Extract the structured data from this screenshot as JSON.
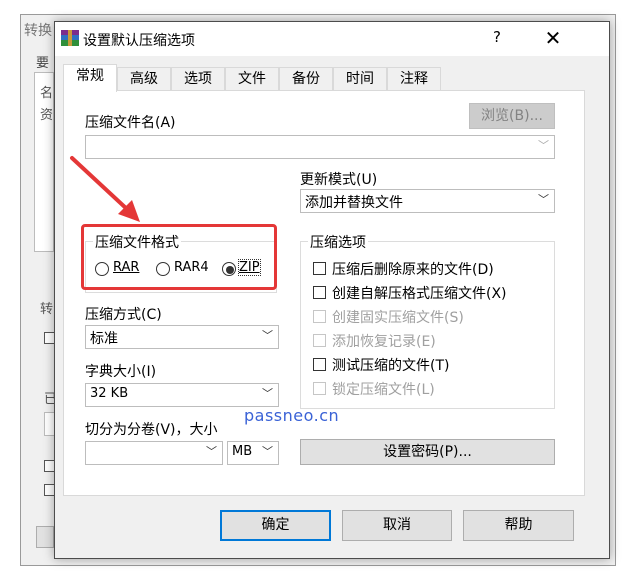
{
  "background_window": {
    "title": "转换",
    "label": "要",
    "text_lines": [
      "名",
      "资"
    ],
    "side_label_a": "转",
    "side_label_b": "已"
  },
  "dialog": {
    "title": "设置默认压缩选项",
    "help_label": "?",
    "close_label": "✕"
  },
  "tabs": [
    {
      "label": "常规",
      "active": true
    },
    {
      "label": "高级"
    },
    {
      "label": "选项"
    },
    {
      "label": "文件"
    },
    {
      "label": "备份"
    },
    {
      "label": "时间"
    },
    {
      "label": "注释"
    }
  ],
  "general": {
    "archive_name_label": "压缩文件名(A)",
    "archive_name_value": "",
    "browse_label": "浏览(B)...",
    "update_mode_label": "更新模式(U)",
    "update_mode_value": "添加并替换文件",
    "format_group_title": "压缩文件格式",
    "formats": [
      {
        "label": "RAR",
        "checked": false
      },
      {
        "label": "RAR4",
        "checked": false
      },
      {
        "label": "ZIP",
        "checked": true
      }
    ],
    "method_label": "压缩方式(C)",
    "method_value": "标准",
    "dict_label": "字典大小(I)",
    "dict_value": "32 KB",
    "split_label": "切分为分卷(V)，大小",
    "split_value": "",
    "split_unit": "MB",
    "options_group_title": "压缩选项",
    "options": [
      {
        "label": "压缩后删除原来的文件(D)",
        "enabled": true,
        "checked": false
      },
      {
        "label": "创建自解压格式压缩文件(X)",
        "enabled": true,
        "checked": false
      },
      {
        "label": "创建固实压缩文件(S)",
        "enabled": false,
        "checked": false
      },
      {
        "label": "添加恢复记录(E)",
        "enabled": false,
        "checked": false
      },
      {
        "label": "测试压缩的文件(T)",
        "enabled": true,
        "checked": false
      },
      {
        "label": "锁定压缩文件(L)",
        "enabled": false,
        "checked": false
      }
    ],
    "set_password_label": "设置密码(P)..."
  },
  "footer": {
    "ok_label": "确定",
    "cancel_label": "取消",
    "help_label": "帮助"
  },
  "watermark": "passneo.cn",
  "colors": {
    "highlight": "#e43737",
    "accent": "#0078d7",
    "watermark": "#3a62d6"
  }
}
